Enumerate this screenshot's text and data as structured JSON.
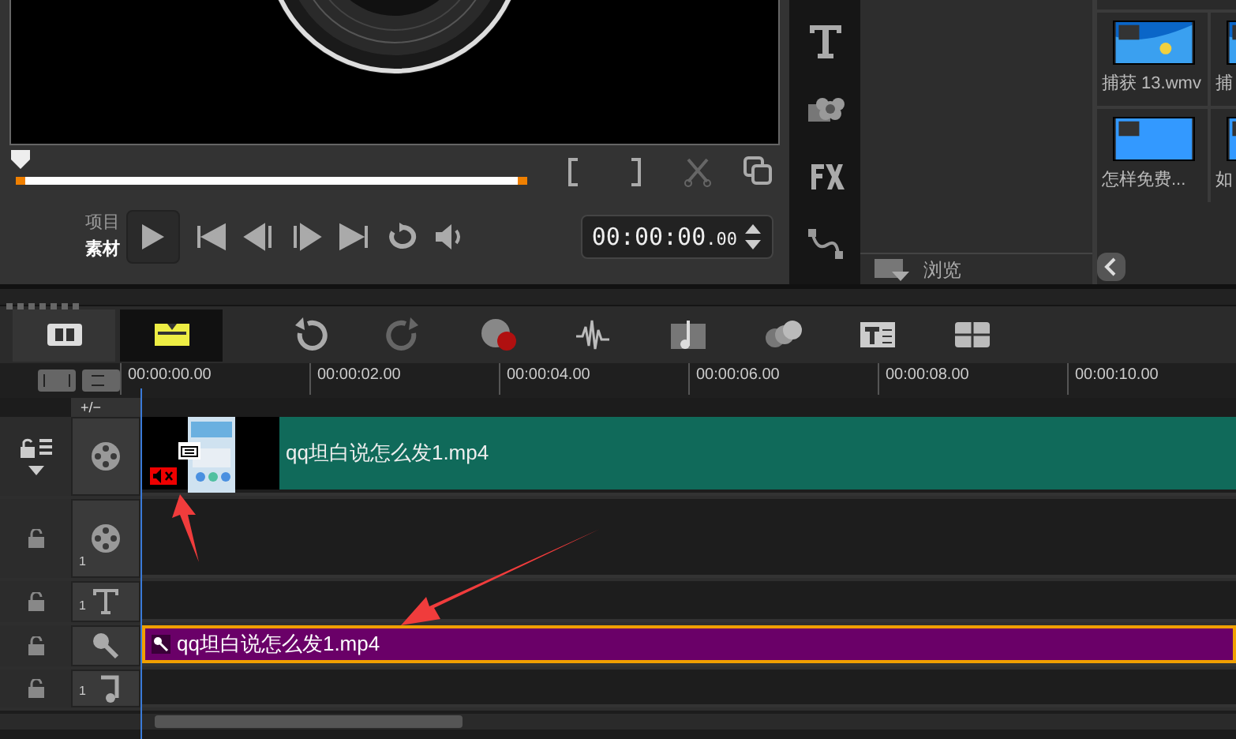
{
  "preview": {
    "scrubber": {
      "level": 0
    },
    "mode_switch": [
      {
        "label": "项目",
        "selected": false
      },
      {
        "label": "素材",
        "selected": true
      }
    ],
    "timecode": {
      "main": "00:00:00",
      "fraction": ".00"
    }
  },
  "library": {
    "browse_label": "浏览",
    "thumbnails": [
      {
        "label": "捕获 13.wmv",
        "kind": "desktop"
      },
      {
        "label": "捕",
        "kind": "desktop"
      },
      {
        "label": "怎样免费...",
        "kind": "blank"
      },
      {
        "label": "如",
        "kind": "blank"
      }
    ]
  },
  "timeline": {
    "view_buttons": [
      {
        "kind": "storyboard",
        "selected": false
      },
      {
        "kind": "timeline",
        "selected": true
      }
    ],
    "ruler": [
      "00:00:00.00",
      "00:00:02.00",
      "00:00:04.00",
      "00:00:06.00",
      "00:00:08.00",
      "00:00:10.00"
    ],
    "add_track_label": "+/−",
    "tracks": [
      {
        "kind": "video",
        "clip": {
          "kind": "video",
          "title": "qq坦白说怎么发1.mp4",
          "muted": true
        }
      },
      {
        "kind": "overlay",
        "number": "1"
      },
      {
        "kind": "title",
        "number": "1"
      },
      {
        "kind": "voice",
        "clip": {
          "kind": "audio",
          "title": "qq坦白说怎么发1.mp4"
        }
      },
      {
        "kind": "music",
        "number": "1"
      }
    ]
  }
}
